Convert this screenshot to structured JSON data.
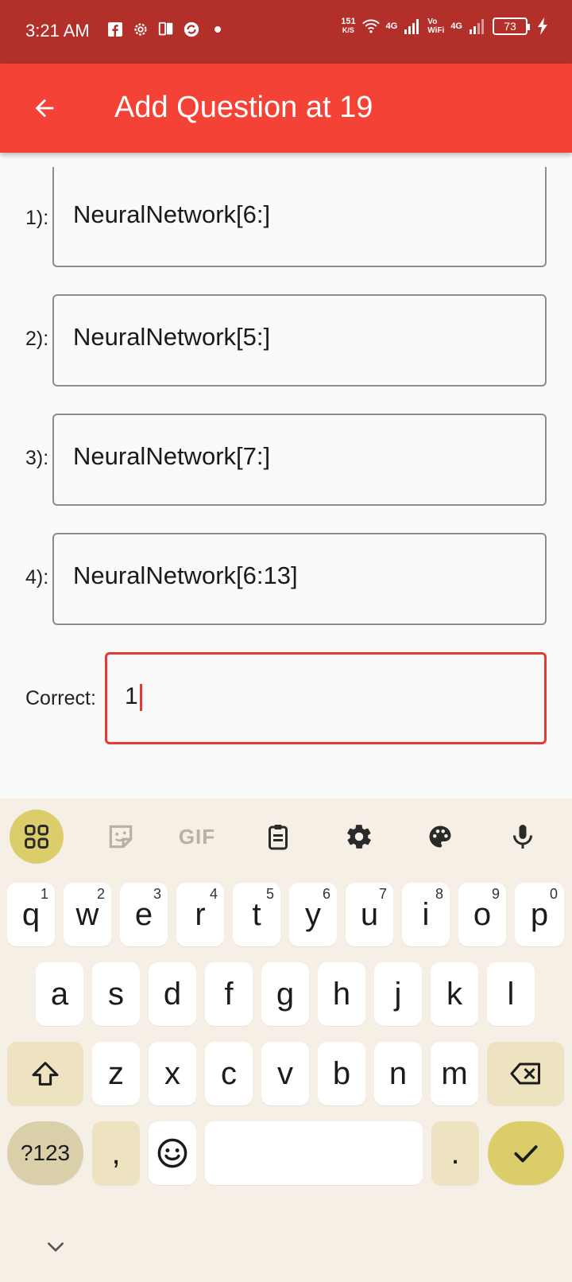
{
  "status_bar": {
    "time": "3:21 AM",
    "speed_value": "151",
    "speed_unit": "K/S",
    "net1": "4G",
    "net2_top": "Vo",
    "net2_bottom": "WiFi",
    "net3": "4G",
    "battery": "73"
  },
  "app_bar": {
    "title": "Add Question at 19"
  },
  "form": {
    "answers": [
      {
        "label": "1):",
        "value": "NeuralNetwork[6:]"
      },
      {
        "label": "2):",
        "value": "NeuralNetwork[5:]"
      },
      {
        "label": "3):",
        "value": "NeuralNetwork[7:]"
      },
      {
        "label": "4):",
        "value": "NeuralNetwork[6:13]"
      }
    ],
    "correct_label": "Correct:",
    "correct_value": "1"
  },
  "keyboard": {
    "toolbar": [
      "apps-grid-icon",
      "sticker-icon",
      "gif",
      "clipboard-icon",
      "settings-icon",
      "palette-icon",
      "microphone-icon"
    ],
    "gif_label": "GIF",
    "row1": [
      {
        "k": "q",
        "h": "1"
      },
      {
        "k": "w",
        "h": "2"
      },
      {
        "k": "e",
        "h": "3"
      },
      {
        "k": "r",
        "h": "4"
      },
      {
        "k": "t",
        "h": "5"
      },
      {
        "k": "y",
        "h": "6"
      },
      {
        "k": "u",
        "h": "7"
      },
      {
        "k": "i",
        "h": "8"
      },
      {
        "k": "o",
        "h": "9"
      },
      {
        "k": "p",
        "h": "0"
      }
    ],
    "row2": [
      "a",
      "s",
      "d",
      "f",
      "g",
      "h",
      "j",
      "k",
      "l"
    ],
    "row3": [
      "z",
      "x",
      "c",
      "v",
      "b",
      "n",
      "m"
    ],
    "symbols_label": "?123",
    "comma": ",",
    "period": "."
  }
}
